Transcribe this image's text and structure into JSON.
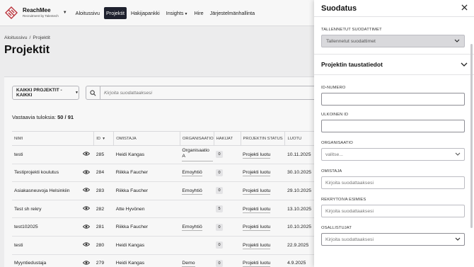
{
  "app": {
    "name": "ReachMee",
    "subtitle": "Recruitment by Talentech",
    "brand_color": "#c2353d"
  },
  "nav": {
    "items": [
      {
        "label": "Aloitussivu",
        "active": false
      },
      {
        "label": "Projektit",
        "active": true
      },
      {
        "label": "Hakijapankki",
        "active": false
      },
      {
        "label": "Insights",
        "active": false,
        "has_caret": true
      },
      {
        "label": "Hire",
        "active": false
      },
      {
        "label": "Järjestelmänhallinta",
        "active": false
      }
    ]
  },
  "breadcrumb": {
    "items": [
      "Aloitussivu",
      "/",
      "Projektit"
    ]
  },
  "page": {
    "title": "Projektit"
  },
  "toolbar": {
    "filter_label": "KAIKKI PROJEKTIT - KAIKKI",
    "search_placeholder": "Kirjoita suodattaaksesi"
  },
  "results": {
    "label": "Vastaavia tuloksia:",
    "shown": "50",
    "separator": "/",
    "total": "91"
  },
  "table": {
    "headers": {
      "name": "NIMI",
      "id": "ID",
      "owner": "OMISTAJA",
      "org": "ORGANISAATIO",
      "applicants": "HAKIJAT",
      "status": "PROJEKTIN STATUS",
      "created": "LUOTU"
    },
    "rows": [
      {
        "name": "testi",
        "id": "285",
        "owner": "Heidi Kangas",
        "org": "Organisaatio A",
        "applicants": "0",
        "status": "Projekti luotu",
        "created": "10.11.2025"
      },
      {
        "name": "Testiprojekti koulutus",
        "id": "284",
        "owner": "Riikka Faucher",
        "org": "Emoyhtiö",
        "applicants": "0",
        "status": "Projekti luotu",
        "created": "30.10.2025"
      },
      {
        "name": "Asiakasneuvoja Helsinkiin",
        "id": "283",
        "owner": "Riikka Faucher",
        "org": "Emoyhtiö",
        "applicants": "0",
        "status": "Projekti luotu",
        "created": "29.10.2025"
      },
      {
        "name": "Test sh rekry",
        "id": "282",
        "owner": "Atte Hyvönen",
        "org": "",
        "applicants": "5",
        "status": "Projekti luotu",
        "created": "13.10.2025"
      },
      {
        "name": "test102025",
        "id": "281",
        "owner": "Riikka Faucher",
        "org": "Emoyhtiö",
        "applicants": "0",
        "status": "Projekti luotu",
        "created": "10.10.2025"
      },
      {
        "name": "testi",
        "id": "280",
        "owner": "Heidi Kangas",
        "org": "",
        "applicants": "0",
        "status": "Projekti luotu",
        "created": "22.9.2025"
      },
      {
        "name": "Myyntiedustaja",
        "id": "279",
        "owner": "Heidi Kangas",
        "org": "Demo",
        "applicants": "0",
        "status": "Projekti luotu",
        "created": "4.9.2025"
      }
    ]
  },
  "panel": {
    "title": "Suodatus",
    "saved_filters_label": "TALLENNETUT SUODATTIMET",
    "saved_filters_value": "Tallennetut suodattimet",
    "section_title": "Projektin taustatiedot",
    "fields": {
      "id_label": "ID-NUMERO",
      "external_id_label": "ULKOINEN ID",
      "org_label": "ORGANISAATIO",
      "org_placeholder": "valitse...",
      "owner_label": "OMISTAJA",
      "owner_placeholder": "Kirjoita suodattaaksesi",
      "manager_label": "REKRYTOIVA ESIMIES",
      "manager_placeholder": "Kirjoita suodattaaksesi",
      "participants_label": "OSALLISTUJAT",
      "participants_placeholder": "Kirjoita suodattaaksesi"
    }
  }
}
